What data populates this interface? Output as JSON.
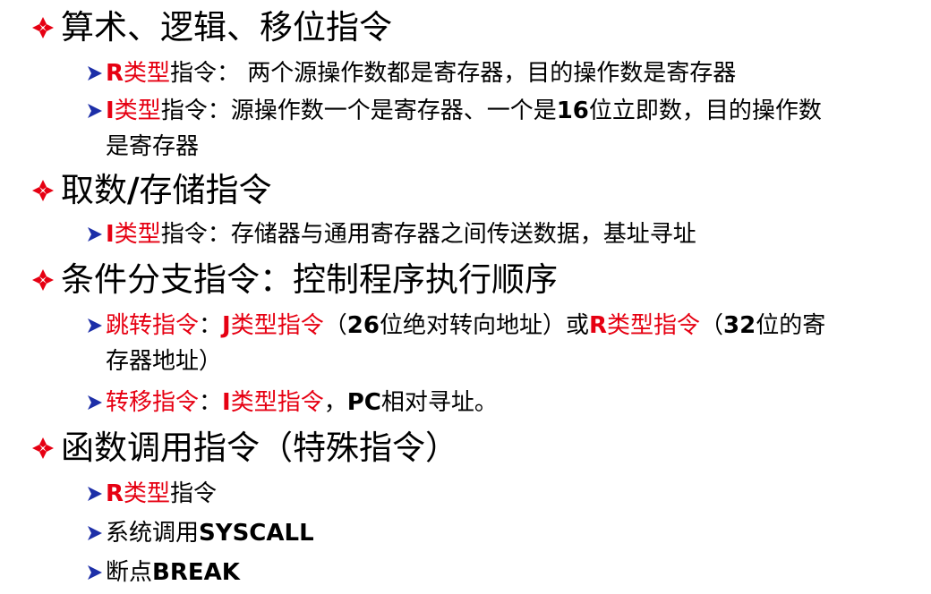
{
  "colors": {
    "accent_red": "#e60012",
    "bullet_red": "#e60012",
    "arrow_blue": "#1d2fa8",
    "text": "#000000"
  },
  "icons": {
    "level1_bullet": "diamond-bullet-icon",
    "level2_bullet": "arrow-bullet-icon"
  },
  "sections": [
    {
      "title": "算术、逻辑、移位指令",
      "items": [
        {
          "type_label": "R",
          "type_suffix": "类型",
          "after": "指令：  两个源操作数都是寄存器，目的操作数是寄存器"
        },
        {
          "type_label": "I",
          "type_suffix": "类型",
          "part1": "指令：源操作数一个是寄存器、一个是",
          "num": "16",
          "part2": "位立即数，目的操作数",
          "cont": "是寄存器"
        }
      ]
    },
    {
      "title_a": "取数",
      "title_slash": "/",
      "title_b": "存储指令",
      "items": [
        {
          "type_label": "I",
          "type_suffix": "类型",
          "after": "指令：存储器与通用寄存器之间传送数据，基址寻址"
        }
      ]
    },
    {
      "title": "条件分支指令：控制程序执行顺序",
      "items": [
        {
          "lead": "跳转指令",
          "colon": "：",
          "j_label": "J",
          "j_suffix": "类型指令",
          "paren1_open": "（",
          "num1": "26",
          "paren1_text": "位绝对转向地址）或",
          "r_label": "R",
          "r_suffix": "类型指令",
          "paren2_open": "（",
          "num2": "32",
          "paren2_text": "位的寄",
          "cont": "存器地址）"
        },
        {
          "lead": "转移指令",
          "colon": "：",
          "i_label": "I",
          "i_suffix": "类型指令",
          "comma": "，",
          "pc": "PC",
          "rest": "相对寻址。"
        }
      ]
    },
    {
      "title": "函数调用指令（特殊指令）",
      "items": [
        {
          "type_label": "R",
          "type_suffix": "类型",
          "after": "指令"
        },
        {
          "pre": "系统调用",
          "code": "SYSCALL"
        },
        {
          "pre": "断点",
          "code": "BREAK"
        }
      ]
    }
  ]
}
